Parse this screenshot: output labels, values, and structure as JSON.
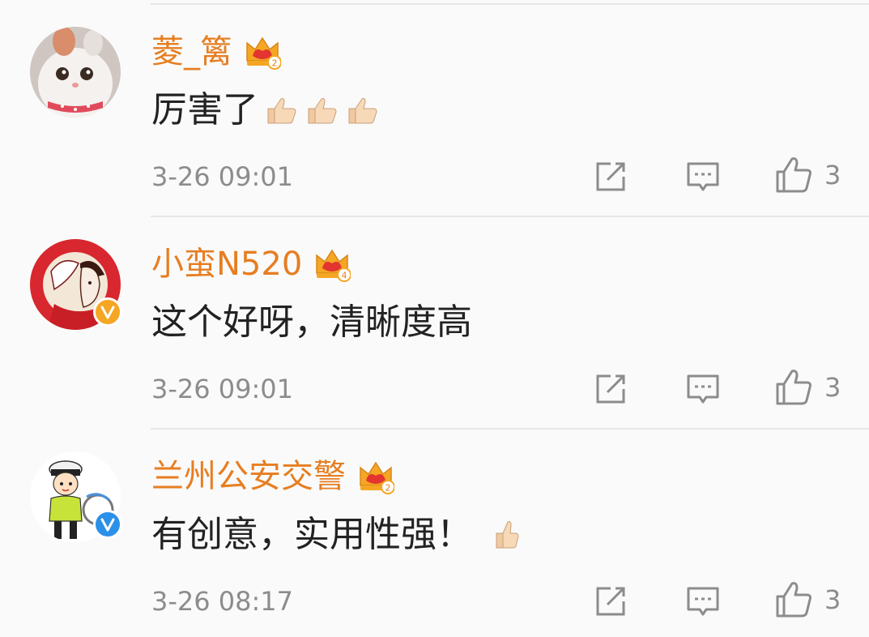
{
  "comments": [
    {
      "username": "菱_篱",
      "member_level": "2",
      "text": "厉害了",
      "thumbs": 3,
      "timestamp": "3-26 09:01",
      "like_count": "3",
      "verified": "none"
    },
    {
      "username": "小蛮N520",
      "member_level": "4",
      "text": "这个好呀，清晰度高",
      "thumbs": 0,
      "timestamp": "3-26 09:01",
      "like_count": "3",
      "verified": "gold"
    },
    {
      "username": "兰州公安交警",
      "member_level": "2",
      "text": "有创意，实用性强！",
      "thumbs": 1,
      "timestamp": "3-26 08:17",
      "like_count": "3",
      "verified": "blue"
    }
  ],
  "colors": {
    "username": "#e67e22",
    "meta": "#8c8c8c",
    "icon": "#8c8c8c",
    "crown": "#f5a623",
    "verified_gold": "#f5a623",
    "verified_blue": "#2b90e8"
  },
  "icons": {
    "repost": "share-edit-icon",
    "comment": "comment-icon",
    "like": "thumbs-up-icon",
    "member": "crown-icon"
  }
}
